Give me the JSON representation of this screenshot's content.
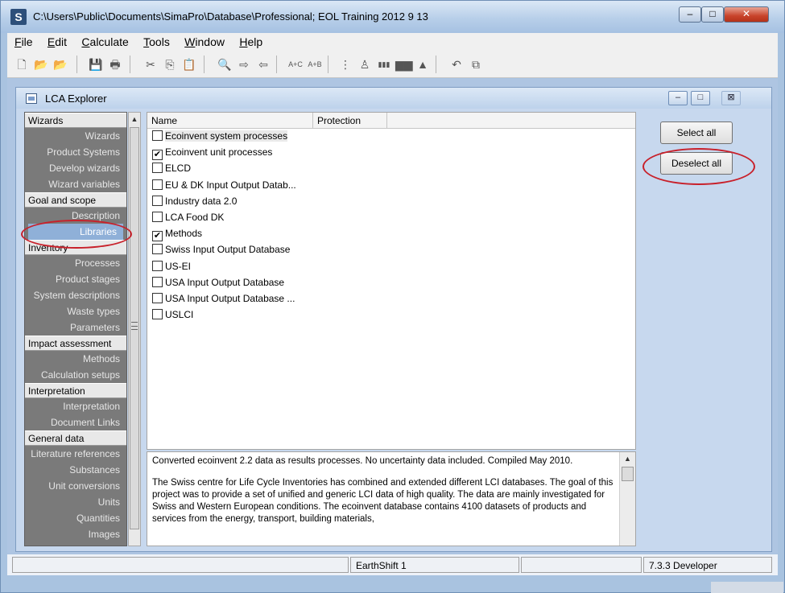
{
  "window": {
    "title": "C:\\Users\\Public\\Documents\\SimaPro\\Database\\Professional; EOL Training 2012 9 13",
    "app_icon": "S",
    "minimize": "–",
    "maximize": "□",
    "close": "✕"
  },
  "menu": [
    "File",
    "Edit",
    "Calculate",
    "Tools",
    "Window",
    "Help"
  ],
  "toolbar": {
    "icons": [
      "new-icon",
      "open-icon",
      "open-library-icon",
      "save-icon",
      "print-icon",
      "cut-icon",
      "copy-icon",
      "paste-icon",
      "find-icon",
      "import-icon",
      "export-icon",
      "lci-results-icon",
      "scale-icon",
      "tree-icon",
      "network-icon",
      "bar-chart-icon",
      "stacked-chart-icon",
      "distribution-icon",
      "undo-icon",
      "compare-icon"
    ],
    "glyphs": [
      "🗋",
      "📂",
      "📂",
      "💾",
      "🖶",
      "✂",
      "⎘",
      "📋",
      "🔍",
      "⇨",
      "⇦",
      "A+C",
      "A+B",
      "⋮",
      "♙",
      "▮▮▮",
      "▆▆",
      "▲",
      "↶",
      "⧉"
    ]
  },
  "explorer": {
    "title": "LCA Explorer",
    "min": "–",
    "max": "□",
    "close": "⊠"
  },
  "nav": {
    "sections": [
      {
        "header": "Wizards",
        "items": [
          "Wizards",
          "Product Systems",
          "Develop wizards",
          "Wizard variables"
        ]
      },
      {
        "header": "Goal and scope",
        "items": [
          "Description",
          "Libraries"
        ]
      },
      {
        "header": "Inventory",
        "items": [
          "Processes",
          "Product stages",
          "System descriptions",
          "Waste types",
          "Parameters"
        ]
      },
      {
        "header": "Impact assessment",
        "items": [
          "Methods",
          "Calculation setups"
        ]
      },
      {
        "header": "Interpretation",
        "items": [
          "Interpretation",
          "Document Links"
        ]
      },
      {
        "header": "General data",
        "items": [
          "Literature references",
          "Substances",
          "Unit conversions",
          "Units",
          "Quantities",
          "Images"
        ]
      }
    ],
    "selected": "Libraries"
  },
  "list": {
    "columns": [
      "Name",
      "Protection"
    ],
    "rows": [
      {
        "label": "Ecoinvent system processes",
        "checked": false
      },
      {
        "label": "Ecoinvent unit processes",
        "checked": true
      },
      {
        "label": "ELCD",
        "checked": false
      },
      {
        "label": "EU & DK Input Output Datab...",
        "checked": false
      },
      {
        "label": "Industry data 2.0",
        "checked": false
      },
      {
        "label": "LCA Food DK",
        "checked": false
      },
      {
        "label": "Methods",
        "checked": true
      },
      {
        "label": "Swiss Input Output Database",
        "checked": false
      },
      {
        "label": "US-EI",
        "checked": false
      },
      {
        "label": "USA Input Output Database",
        "checked": false
      },
      {
        "label": "USA Input Output Database ...",
        "checked": false
      },
      {
        "label": "USLCI",
        "checked": false
      }
    ]
  },
  "description": {
    "p1": "Converted ecoinvent 2.2 data as results processes. No uncertainty data included. Compiled May 2010.",
    "p2": "The Swiss centre for Life Cycle Inventories has combined and extended different LCI databases. The goal of this project was to provide a set of unified and generic LCI data of high quality. The data are mainly investigated for Swiss and Western European conditions. The ecoinvent database contains 4100 datasets of products and services from the energy, transport, building materials,"
  },
  "buttons": {
    "select_all": "Select all",
    "deselect_all": "Deselect all"
  },
  "statusbar": [
    "",
    "EarthShift 1",
    "",
    "7.3.3 Developer"
  ],
  "annotation_color": "#c8202a"
}
